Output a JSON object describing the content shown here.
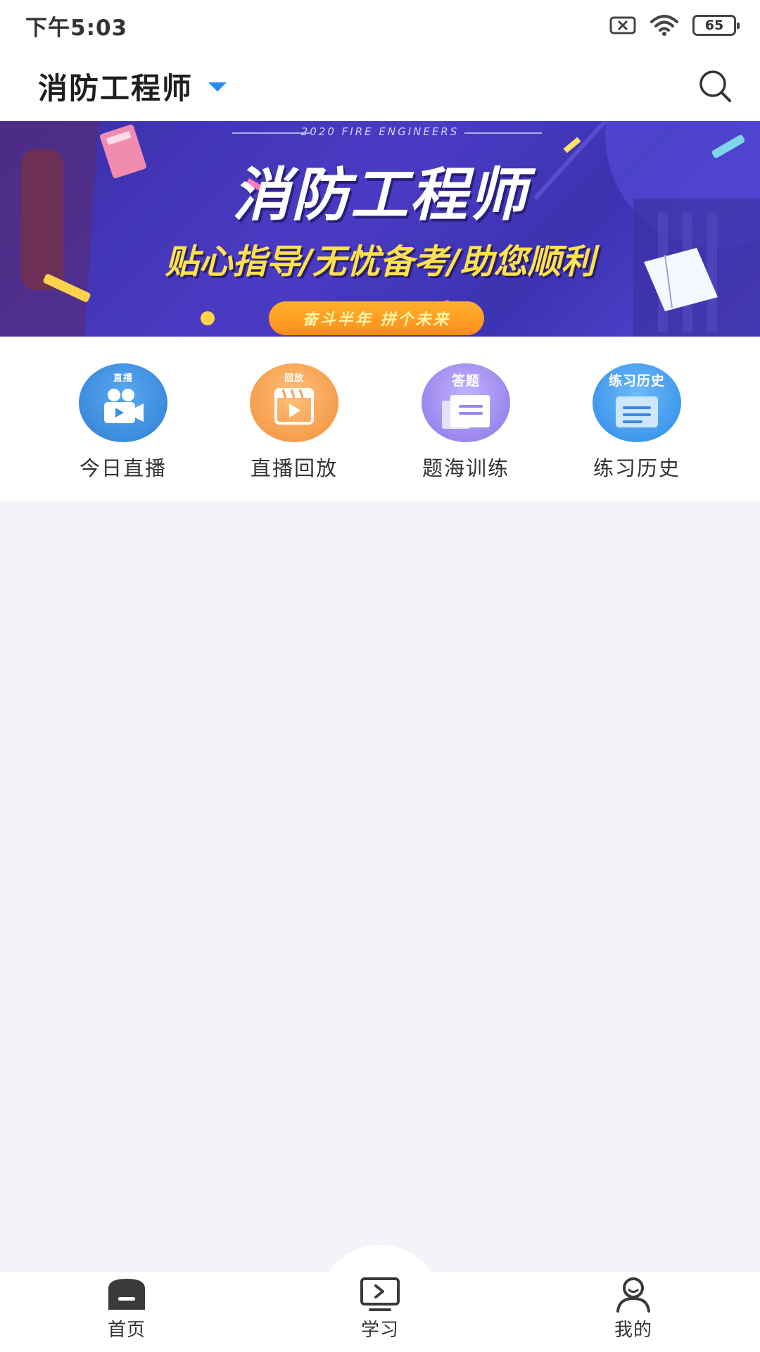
{
  "status_bar": {
    "time": "下午5:03",
    "battery_level": "65",
    "icons": [
      "sim-off-icon",
      "wifi-icon",
      "battery-icon"
    ]
  },
  "header": {
    "title": "消防工程师",
    "dropdown_icon": "caret-down-icon",
    "search_icon": "search-icon",
    "accent_color": "#2a8cf0"
  },
  "banner": {
    "subtitle": "2020 FIRE ENGINEERS",
    "title": "消防工程师",
    "slogan": "贴心指导/无忧备考/助您顺利",
    "pill_text": "奋斗半年  拼个未来"
  },
  "quick_entries": [
    {
      "label": "今日直播",
      "icon": "live-camera-icon",
      "tag": "直播",
      "color": "#3d8fe0"
    },
    {
      "label": "直播回放",
      "icon": "replay-video-icon",
      "tag": "回放",
      "color": "#f5a04a"
    },
    {
      "label": "题海训练",
      "icon": "quiz-paper-icon",
      "tag": "答题",
      "color": "#9a86ea"
    },
    {
      "label": "练习历史",
      "icon": "history-list-icon",
      "tag": "练习历史",
      "color": "#3a9af0"
    }
  ],
  "tabbar": {
    "items": [
      {
        "label": "首页",
        "icon": "home-icon",
        "active": true
      },
      {
        "label": "学习",
        "icon": "study-screen-icon",
        "active": false
      },
      {
        "label": "我的",
        "icon": "profile-icon",
        "active": false
      }
    ]
  }
}
